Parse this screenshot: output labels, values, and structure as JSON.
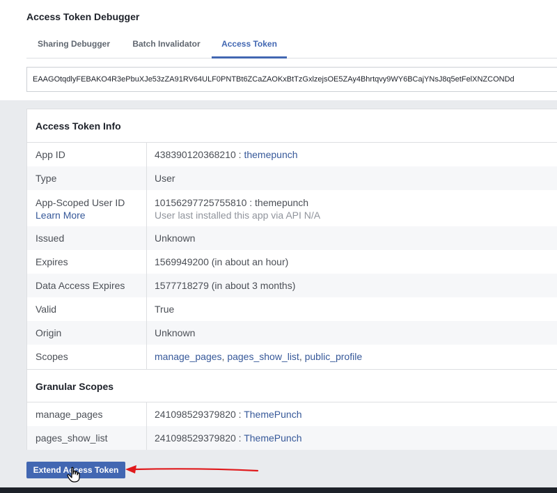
{
  "page": {
    "title": "Access Token Debugger",
    "tabs": [
      {
        "label": "Sharing Debugger"
      },
      {
        "label": "Batch Invalidator"
      },
      {
        "label": "Access Token"
      }
    ],
    "token_value": "EAAGOtqdlyFEBAKO4R3ePbuXJe53zZA91RV64ULF0PNTBt6ZCaZAOKxBtTzGxlzejsOE5ZAy4Bhrtqvy9WY6BCajYNsJ8q5etFelXNZCONDd"
  },
  "info": {
    "header": "Access Token Info",
    "rows": [
      {
        "label": "App ID",
        "value_num": "438390120368210",
        "sep": " : ",
        "value_link": "themepunch"
      },
      {
        "label": "Type",
        "value_link": "User"
      },
      {
        "label": "App-Scoped User ID",
        "label_link": "Learn More",
        "value": "10156297725755810 : themepunch",
        "value_sub": "User last installed this app via API N/A"
      },
      {
        "label": "Issued",
        "value": "Unknown"
      },
      {
        "label": "Expires",
        "value": "1569949200 (in about an hour)"
      },
      {
        "label": "Data Access Expires",
        "value": "1577718279 (in about 3 months)"
      },
      {
        "label": "Valid",
        "value": "True"
      },
      {
        "label": "Origin",
        "value": "Unknown"
      },
      {
        "label": "Scopes",
        "scopes": [
          "manage_pages",
          "pages_show_list",
          "public_profile"
        ]
      }
    ]
  },
  "granular": {
    "header": "Granular Scopes",
    "rows": [
      {
        "label": "manage_pages",
        "value_num": "241098529379820",
        "sep": " : ",
        "value_link": "ThemePunch"
      },
      {
        "label": "pages_show_list",
        "value_num": "241098529379820",
        "sep": " : ",
        "value_link": "ThemePunch"
      }
    ]
  },
  "extend_button": {
    "label": "Extend Access Token"
  },
  "colors": {
    "brand": "#4267b2",
    "link": "#365899",
    "annotation_arrow": "#e0191b"
  }
}
